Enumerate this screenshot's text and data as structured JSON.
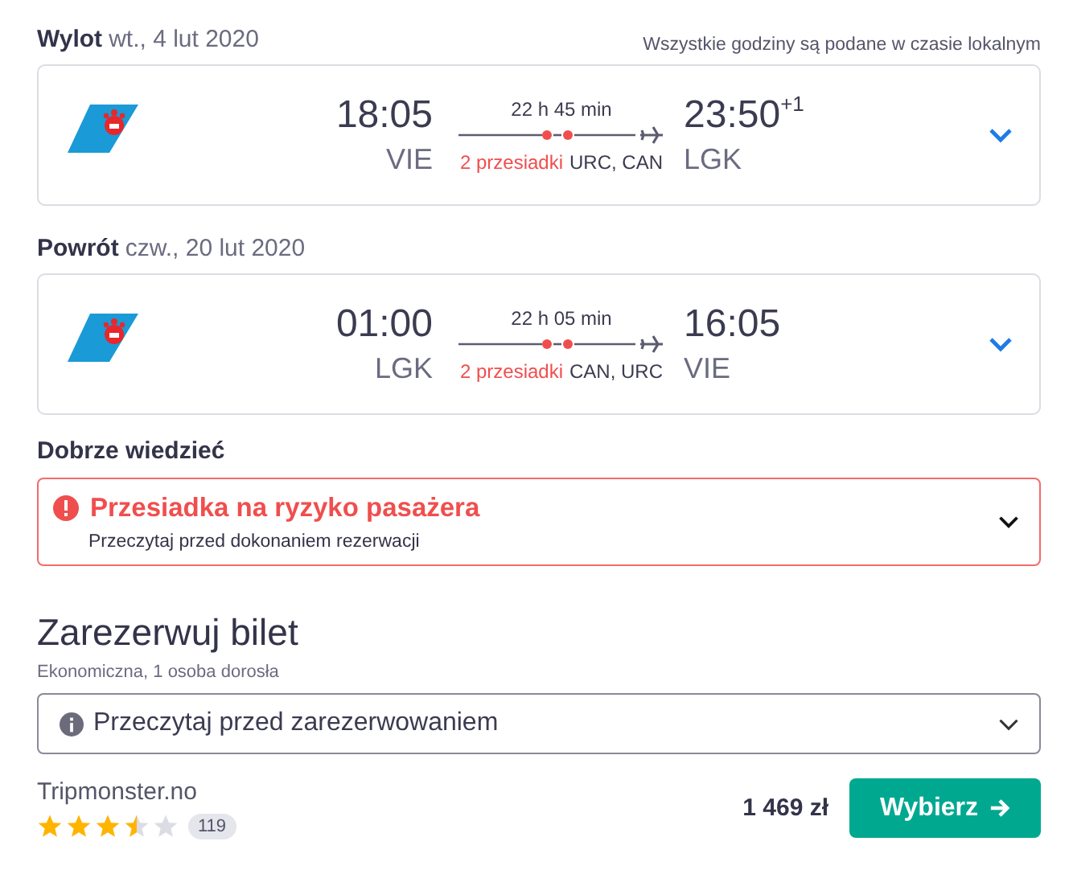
{
  "timezone_note": "Wszystkie godziny są podane w czasie lokalnym",
  "legs": [
    {
      "title": "Wylot",
      "date": "wt., 4 lut 2020",
      "departure_time": "18:05",
      "departure_airport": "VIE",
      "duration": "22 h 45 min",
      "stops_label": "2 przesiadki",
      "stops_airports": "URC, CAN",
      "arrival_time": "23:50",
      "arrival_day_offset": "+1",
      "arrival_airport": "LGK"
    },
    {
      "title": "Powrót",
      "date": "czw., 20 lut 2020",
      "departure_time": "01:00",
      "departure_airport": "LGK",
      "duration": "22 h 05 min",
      "stops_label": "2 przesiadki",
      "stops_airports": "CAN, URC",
      "arrival_time": "16:05",
      "arrival_airport": "VIE"
    }
  ],
  "good_to_know": {
    "heading": "Dobrze wiedzieć",
    "warning_title": "Przesiadka na ryzyko pasażera",
    "warning_text": "Przeczytaj przed dokonaniem rezerwacji"
  },
  "booking": {
    "heading": "Zarezerwuj bilet",
    "subtitle": "Ekonomiczna, 1 osoba dorosła",
    "info_dropdown": "Przeczytaj przed zarezerwowaniem",
    "provider": "Tripmonster.no",
    "stars": 3.5,
    "review_count": "119",
    "price": "1 469 zł",
    "select_button": "Wybierz"
  }
}
